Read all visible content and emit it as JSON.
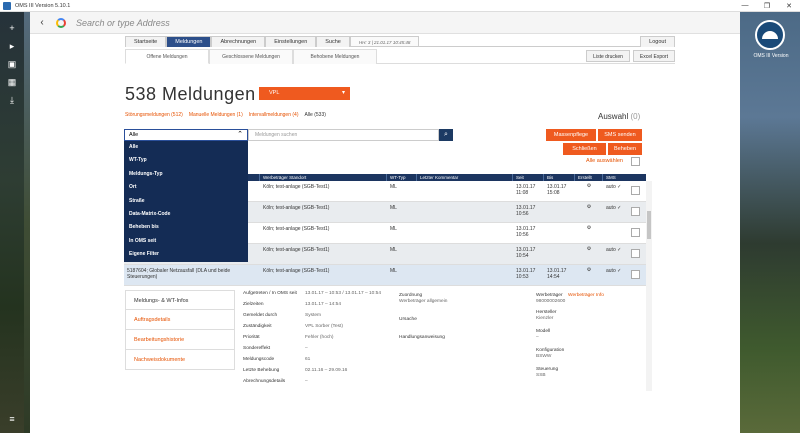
{
  "window": {
    "title": "OMS III Version 5.10.1",
    "minimize": "—",
    "restore": "❐",
    "close": "✕"
  },
  "browser": {
    "back": "‹",
    "address_placeholder": "Search or type Address"
  },
  "brand": {
    "label": "OMS III Version"
  },
  "nav": {
    "tabs": [
      "Startseite",
      "Meldungen",
      "Abrechnungen",
      "Einstellungen",
      "Suche"
    ],
    "stamp": "HH: 3 | 21.01.17 10:45:48",
    "logout": "Logout"
  },
  "subtabs": {
    "open": "Offene Meldungen",
    "closed": "Geschlossene Meldungen",
    "done": "Behobene Meldungen",
    "print": "Liste drucken",
    "excel": "Excel Export"
  },
  "header": {
    "title": "538  Meldungen",
    "filter": "VPL",
    "filter_caret": "▾"
  },
  "counts": {
    "stoerung": "Störungsmeldungen (512)",
    "manuell": "Manuelle Meldungen (1)",
    "intervall": "Intervallmeldungen (4)",
    "alle": "Alle (533)"
  },
  "auswahl": {
    "label": "Auswahl",
    "count": "(0)"
  },
  "search": {
    "selected": "Alle",
    "chevron": "⌃",
    "placeholder": "Meldungen suchen",
    "button": "⌕"
  },
  "actions": {
    "massenpflege": "Massenpflege",
    "sms": "SMS senden",
    "schliessen": "Schließen",
    "beheben": "Beheben",
    "alle_auswaehlen": "Alle auswählen"
  },
  "dropdown": [
    "Alle",
    "WT-Typ",
    "Meldungs-Typ",
    "Ort",
    "Straße",
    "Data-Matrix-Code",
    "Beheben bis",
    "In OMS seit",
    "Eigene Filter"
  ],
  "table": {
    "headers": [
      "",
      "Werbeträger Standort",
      "WT-Typ",
      "Letzter Kommentar",
      "Seit",
      "Bis",
      "Erstellt",
      "SMS"
    ],
    "rows": [
      {
        "desc": "",
        "standort": "Köln; test-anlage (SGB-Test1)",
        "typ": "ML",
        "seit": "13.01.17 11:08",
        "bis": "13.01.17 15:08",
        "sms": "auto ✓"
      },
      {
        "desc": "",
        "standort": "Köln; test-anlage (SGB-Test1)",
        "typ": "ML",
        "seit": "13.01.17 10:56",
        "bis": "",
        "sms": "auto ✓"
      },
      {
        "desc": "",
        "standort": "Köln; test-anlage (SGB-Test1)",
        "typ": "ML",
        "seit": "13.01.17 10:56",
        "bis": "",
        "sms": ""
      },
      {
        "desc": "",
        "standort": "Köln; test-anlage (SGB-Test1)",
        "typ": "ML",
        "seit": "13.01.17 10:54",
        "bis": "",
        "sms": "auto ✓"
      },
      {
        "desc": "5187604; Globaler Netzausfall (DLA und beide Steuerungen)",
        "standort": "Köln; test-anlage (SGB-Test1)",
        "typ": "ML",
        "seit": "13.01.17 10:53",
        "bis": "13.01.17 14:54",
        "sms": "auto ✓"
      }
    ],
    "gear": "⚙"
  },
  "detail": {
    "menu": [
      "Meldungs- & WT-Infos",
      "Auftragsdetails",
      "Bearbeitungshistorie",
      "Nachweisdokumente"
    ],
    "fields": [
      [
        "Aufgetreten / In OMS seit",
        "13.01.17 – 10:53 / 13.01.17 – 10:54"
      ],
      [
        "Zielzeiten",
        "13.01.17 – 14:54"
      ],
      [
        "Gemeldet durch",
        "System"
      ],
      [
        "Zuständigkeit",
        "VPL Sorber (Test)"
      ],
      [
        "Priorität",
        "Fehler (hoch)"
      ],
      [
        "Sondereffekt",
        "–"
      ],
      [
        "Meldungscode",
        "61"
      ],
      [
        "Letzte Behebung",
        "02.11.16 – 29.09.16"
      ],
      [
        "Abrechnungsdetails",
        "–"
      ]
    ],
    "zuordnung_label": "Zuordnung",
    "zuordnung_val": "Werbeträger allgemein",
    "ursache": "Ursache",
    "handlung": "Handlungsanweisung",
    "right": {
      "wt_label": "Werbeträger",
      "wt_val": "98000002600",
      "wt_link": "Werbeträger Info",
      "hersteller_label": "Hersteller",
      "hersteller_val": "Kienzler",
      "modell_label": "Modell",
      "modell_val": "–",
      "konfig_label": "Konfiguration",
      "konfig_val": "BSWW",
      "steuerung_label": "Steuerung",
      "steuerung_val": "SSB"
    }
  }
}
